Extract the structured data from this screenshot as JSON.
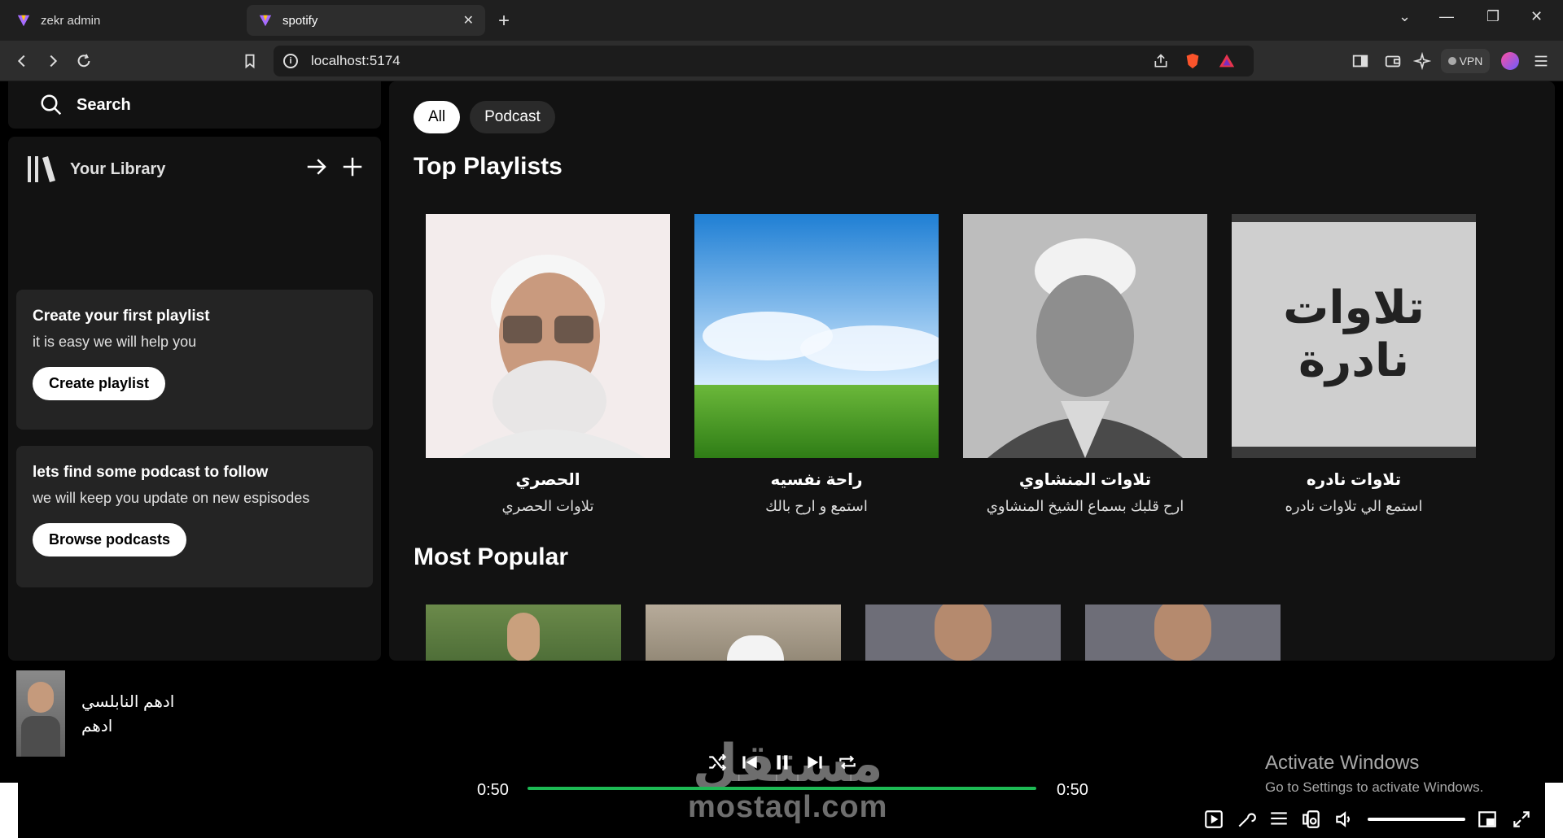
{
  "browser": {
    "tabs": [
      {
        "title": "zekr admin",
        "active": false
      },
      {
        "title": "spotify",
        "active": true
      }
    ],
    "url": "localhost:5174",
    "vpn_label": "VPN"
  },
  "sidebar": {
    "search_label": "Search",
    "library_title": "Your Library",
    "cards": [
      {
        "title": "Create your first playlist",
        "subtitle": "it is easy we will help you",
        "button": "Create playlist"
      },
      {
        "title": "lets find some podcast to follow",
        "subtitle": "we will keep you update on new espisodes",
        "button": "Browse podcasts"
      }
    ]
  },
  "main": {
    "chips": [
      "All",
      "Podcast"
    ],
    "top_playlists_title": "Top Playlists",
    "playlists": [
      {
        "title": "الحصري",
        "subtitle": "تلاوات الحصري"
      },
      {
        "title": "راحة نفسيه",
        "subtitle": "استمع و ارح بالك"
      },
      {
        "title": "تلاوات المنشاوي",
        "subtitle": "ارح قلبك بسماع الشيخ المنشاوي"
      },
      {
        "title": "تلاوات نادره",
        "subtitle": "استمع الي تلاوات نادره",
        "image_text": "تلاوات نادرة"
      }
    ],
    "most_popular_title": "Most Popular"
  },
  "player": {
    "track_title": "ادهم النابلسي",
    "track_artist": "ادهم",
    "time_elapsed": "0:50",
    "time_total": "0:50",
    "progress": 1.0
  },
  "overlay": {
    "watermark_ar": "مستقل",
    "watermark_en": "mostaql.com",
    "activate_title": "Activate Windows",
    "activate_sub": "Go to Settings to activate Windows."
  },
  "colors": {
    "accent": "#1db954",
    "surface": "#121212",
    "card": "#242424"
  }
}
